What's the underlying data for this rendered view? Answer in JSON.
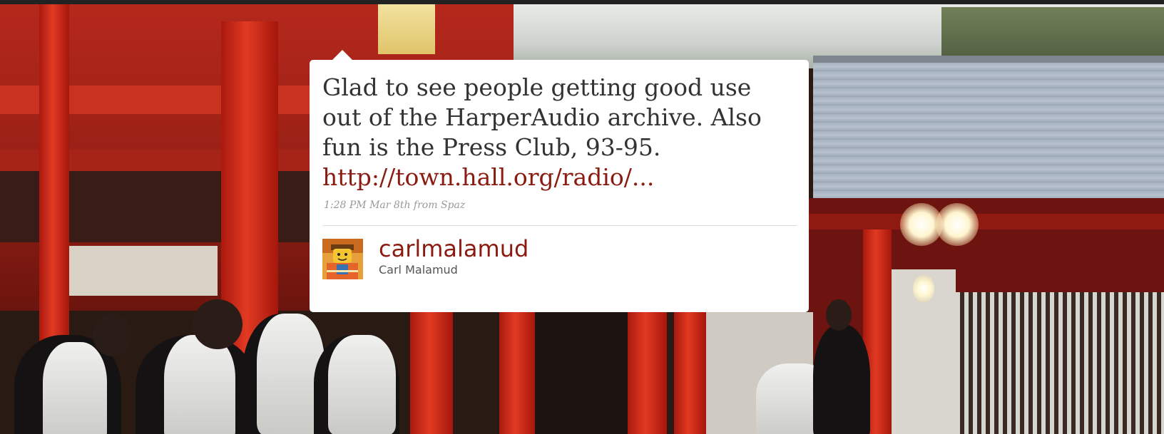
{
  "tweet": {
    "text": "Glad to see people getting good use out of the HarperAudio archive. Also fun is the Press Club, 93-95.",
    "link_text": "http://town.hall.org/radio/...",
    "timestamp": "1:28 PM Mar 8th",
    "source_prefix": "from",
    "source": "Spaz"
  },
  "author": {
    "screen_name": "carlmalamud",
    "full_name": "Carl Malamud",
    "avatar_icon": "lego-figure-avatar"
  },
  "colors": {
    "link": "#8b1a10",
    "card_background": "#ffffff",
    "meta_text": "#999999"
  }
}
